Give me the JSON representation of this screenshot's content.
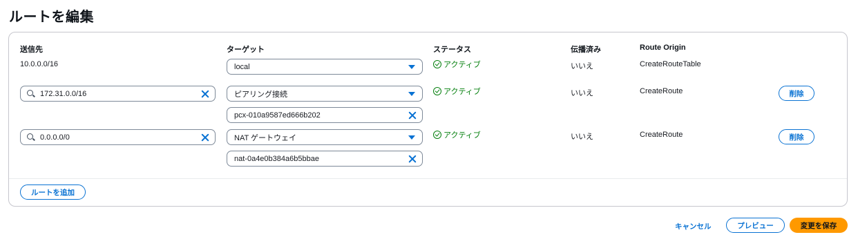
{
  "page": {
    "title": "ルートを編集"
  },
  "columns": {
    "destination": "送信先",
    "target": "ターゲット",
    "status": "ステータス",
    "propagated": "伝播済み",
    "origin": "Route Origin"
  },
  "routes": [
    {
      "destination": "10.0.0.0/16",
      "target": "local",
      "target_id": "",
      "status": "アクティブ",
      "propagated": "いいえ",
      "origin": "CreateRouteTable",
      "remove_label": ""
    },
    {
      "destination": "172.31.0.0/16",
      "target": "ピアリング接続",
      "target_id": "pcx-010a9587ed666b202",
      "status": "アクティブ",
      "propagated": "いいえ",
      "origin": "CreateRoute",
      "remove_label": "削除"
    },
    {
      "destination": "0.0.0.0/0",
      "target": "NAT ゲートウェイ",
      "target_id": "nat-0a4e0b384a6b5bbae",
      "status": "アクティブ",
      "propagated": "いいえ",
      "origin": "CreateRoute",
      "remove_label": "削除"
    }
  ],
  "actions": {
    "add_route": "ルートを追加",
    "cancel": "キャンセル",
    "preview": "プレビュー",
    "save": "変更を保存"
  },
  "colors": {
    "accent": "#0972d3",
    "success": "#037f0c",
    "primary_button": "#ff9900"
  }
}
